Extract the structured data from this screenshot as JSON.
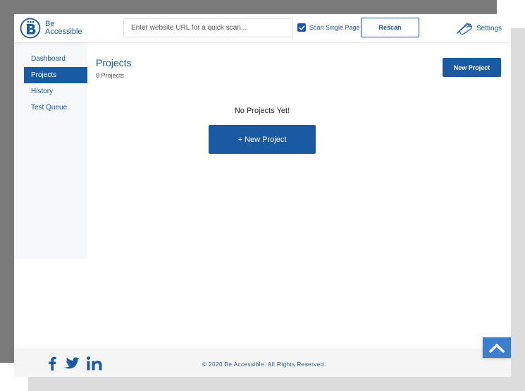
{
  "brand": {
    "line1": "Be",
    "line2": "Accessible"
  },
  "header": {
    "search_placeholder": "Enter website URL for a quick scan...",
    "scan_single_page_label": "Scan Single Page",
    "scan_single_page_checked": true,
    "rescan_label": "Rescan",
    "settings_label": "Settings"
  },
  "sidebar": {
    "items": [
      {
        "label": "Dashboard",
        "active": false
      },
      {
        "label": "Projects",
        "active": true
      },
      {
        "label": "History",
        "active": false
      },
      {
        "label": "Test Queue",
        "active": false
      }
    ]
  },
  "main": {
    "title": "Projects",
    "count_text": "0 Projects",
    "new_project_label": "New Project",
    "empty_text": "No Projects Yet!",
    "empty_button_label": "+ New Project"
  },
  "footer": {
    "copyright": "© 2020 Be Accessible. All Rights Reserved.",
    "social_icons": [
      "facebook-icon",
      "twitter-icon",
      "linkedin-icon"
    ]
  },
  "colors": {
    "primary": "#1a5aa3",
    "scroll_top": "#3a7fd0"
  }
}
